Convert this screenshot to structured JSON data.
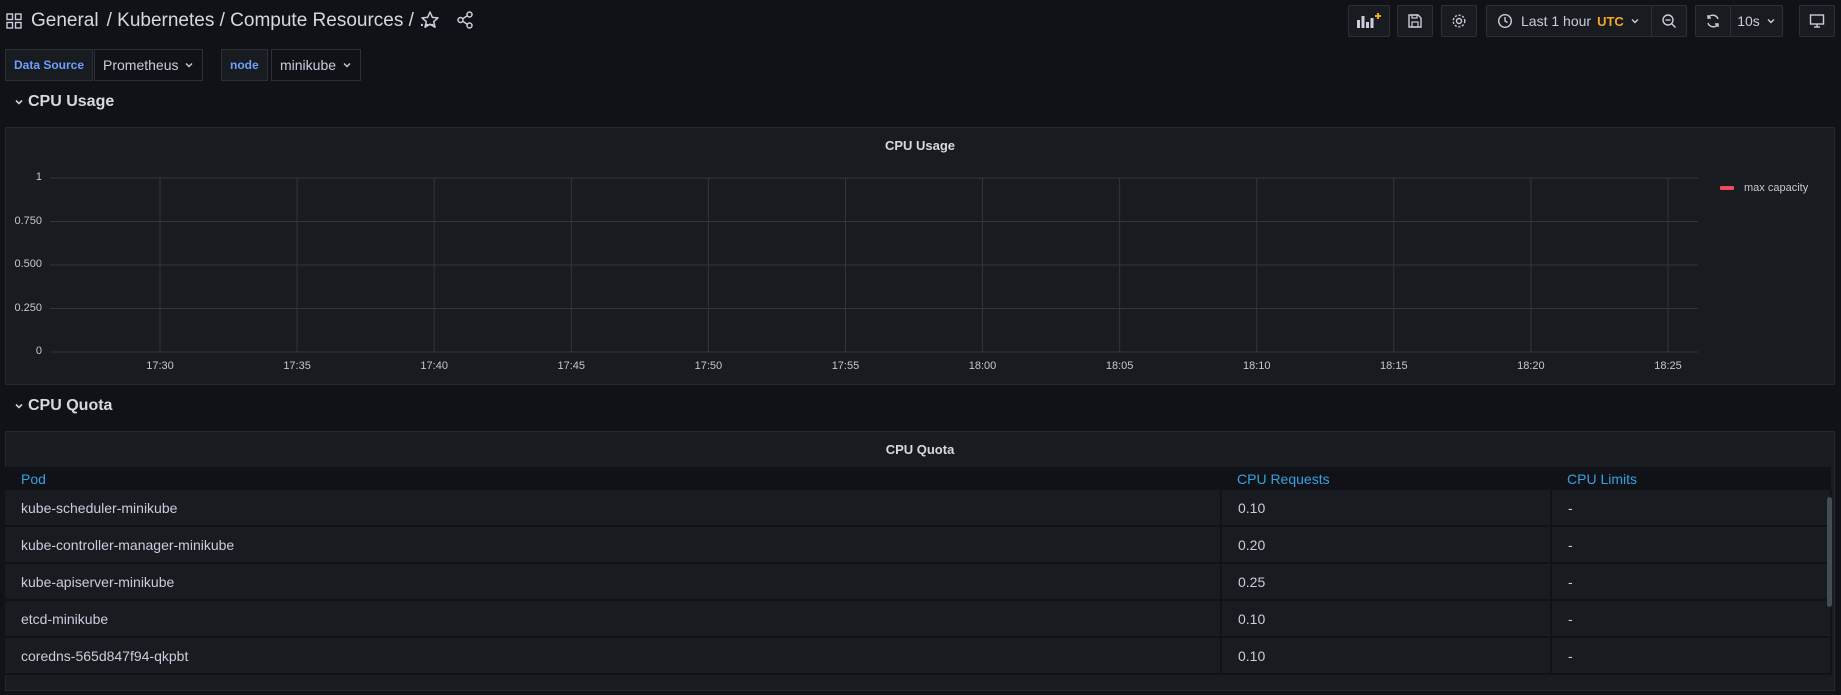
{
  "breadcrumb": {
    "general": "General",
    "path": "/ Kubernetes / Compute Resources / ..."
  },
  "time_picker": {
    "range": "Last 1 hour",
    "timezone": "UTC",
    "refresh": "10s"
  },
  "variables": [
    {
      "label": "Data Source",
      "value": "Prometheus"
    },
    {
      "label": "node",
      "value": "minikube"
    }
  ],
  "rows": {
    "cpu_usage": "CPU Usage",
    "cpu_quota": "CPU Quota"
  },
  "cpu_usage_panel": {
    "title": "CPU Usage",
    "legend": "max capacity"
  },
  "chart_data": {
    "type": "line",
    "title": "CPU Usage",
    "x_ticks": [
      "17:30",
      "17:35",
      "17:40",
      "17:45",
      "17:50",
      "17:55",
      "18:00",
      "18:05",
      "18:10",
      "18:15",
      "18:20",
      "18:25"
    ],
    "y_ticks": [
      "1",
      "0.750",
      "0.500",
      "0.250",
      "0"
    ],
    "ylim": [
      0,
      1
    ],
    "series": [
      {
        "name": "max capacity",
        "values": [],
        "color": "#f2495c"
      }
    ],
    "legend_position": "right",
    "grid": true
  },
  "cpu_quota_panel": {
    "title": "CPU Quota",
    "columns": [
      "Pod",
      "CPU Requests",
      "CPU Limits"
    ],
    "rows": [
      [
        "kube-scheduler-minikube",
        "0.10",
        "-"
      ],
      [
        "kube-controller-manager-minikube",
        "0.20",
        "-"
      ],
      [
        "kube-apiserver-minikube",
        "0.25",
        "-"
      ],
      [
        "etcd-minikube",
        "0.10",
        "-"
      ],
      [
        "coredns-565d847f94-qkpbt",
        "0.10",
        "-"
      ]
    ]
  },
  "colors": {
    "background": "#111217",
    "panel": "#181b1f",
    "accent_blue": "#33a2e5",
    "utc": "#f5a623",
    "series_red": "#f2495c"
  }
}
